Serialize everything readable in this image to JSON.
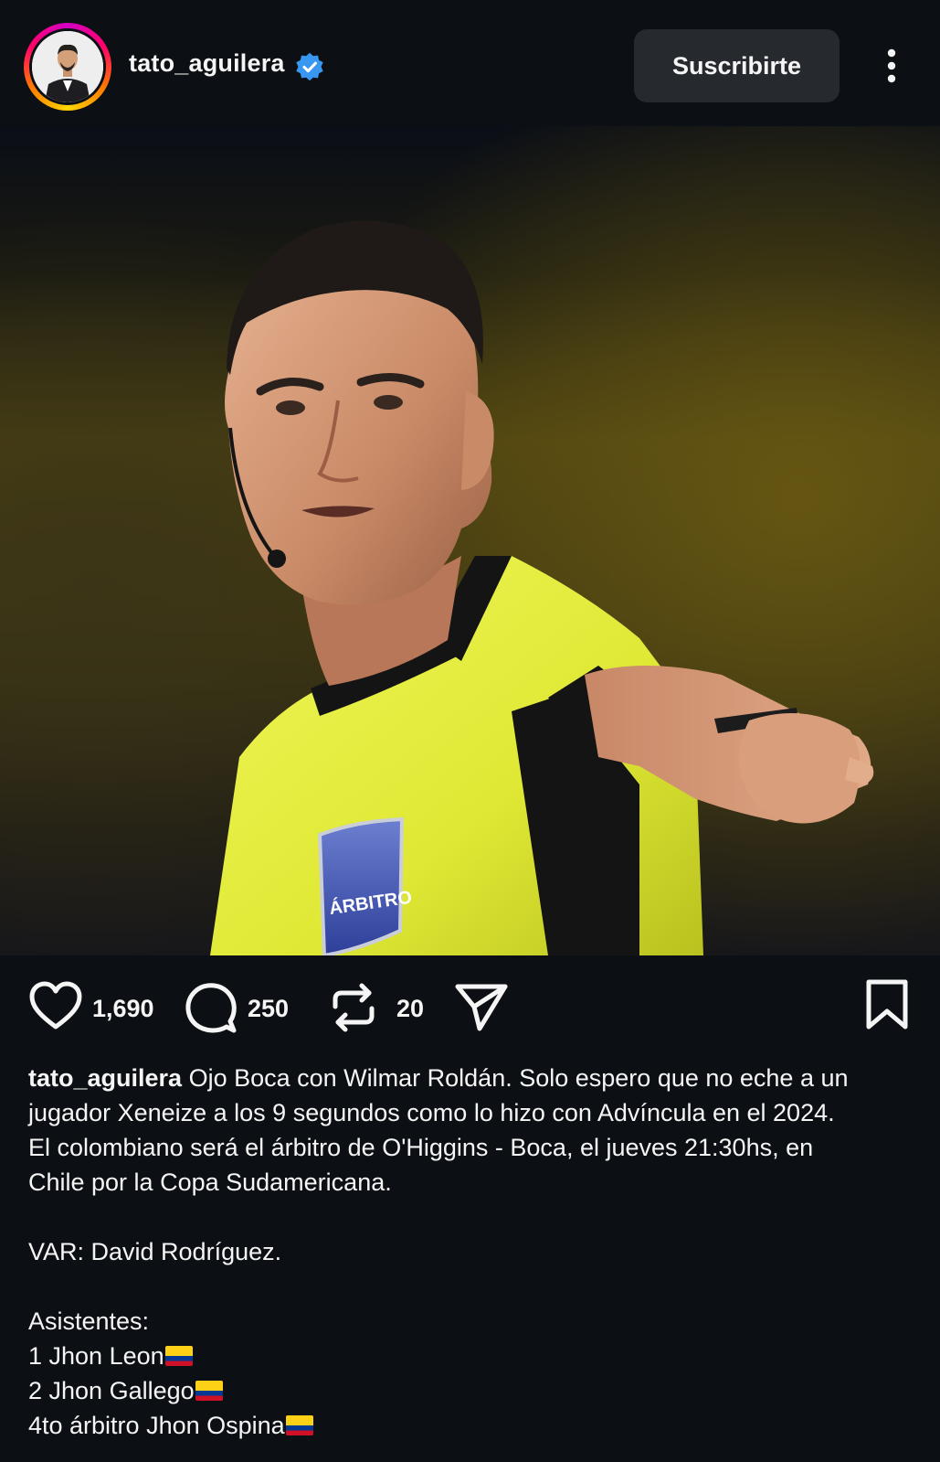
{
  "header": {
    "username": "tato_aguilera",
    "verified": true,
    "subscribe_label": "Suscribirte",
    "more_icon": "more-vertical-icon"
  },
  "photo": {
    "badge_text": "ÁRBITRO"
  },
  "actions": {
    "likes": "1,690",
    "comments": "250",
    "reposts": "20",
    "icons": [
      "heart-icon",
      "comment-icon",
      "repost-icon",
      "share-icon",
      "bookmark-icon"
    ]
  },
  "caption": {
    "username": "tato_aguilera",
    "line1": "Ojo Boca con Wilmar Roldán. Solo espero que no eche a un",
    "line2": "jugador Xeneize a los 9 segundos como lo hizo con Advíncula en el 2024.",
    "line3": "El colombiano será el árbitro de O'Higgins - Boca, el jueves 21:30hs, en",
    "line4": "Chile por la Copa Sudamericana.",
    "var_line": "VAR: David Rodríguez.",
    "assistants_header": "Asistentes:",
    "assistant1": "1 Jhon Leon",
    "assistant2": "2 Jhon Gallego",
    "fourth_official": "4to árbitro Jhon Ospina",
    "flag_icon": "colombia-flag-icon"
  },
  "colors": {
    "background": "#0c1014",
    "button_bg": "#262a2f",
    "verified_blue": "#3897f0",
    "jersey": "#e4f032"
  }
}
